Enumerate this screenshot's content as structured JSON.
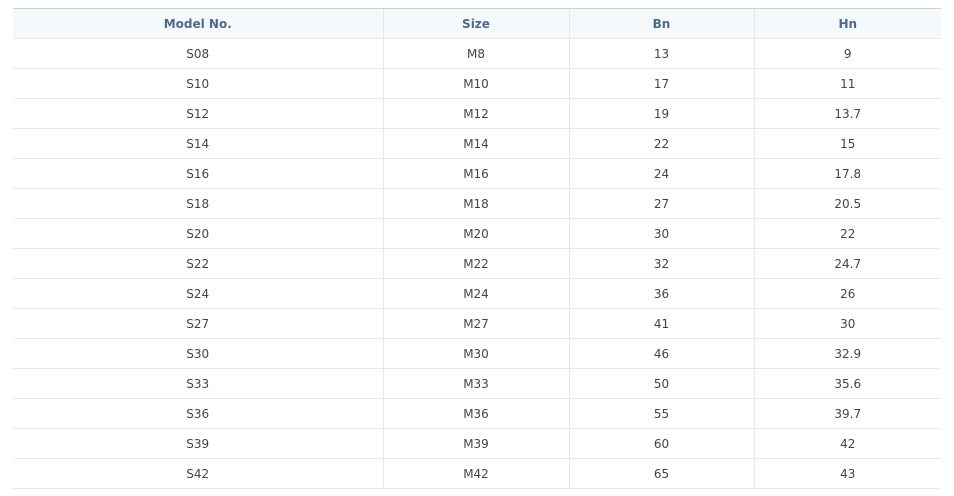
{
  "table": {
    "headers": [
      "Model No.",
      "Size",
      "Bn",
      "Hn"
    ],
    "rows": [
      [
        "S08",
        "M8",
        "13",
        "9"
      ],
      [
        "S10",
        "M10",
        "17",
        "11"
      ],
      [
        "S12",
        "M12",
        "19",
        "13.7"
      ],
      [
        "S14",
        "M14",
        "22",
        "15"
      ],
      [
        "S16",
        "M16",
        "24",
        "17.8"
      ],
      [
        "S18",
        "M18",
        "27",
        "20.5"
      ],
      [
        "S20",
        "M20",
        "30",
        "22"
      ],
      [
        "S22",
        "M22",
        "32",
        "24.7"
      ],
      [
        "S24",
        "M24",
        "36",
        "26"
      ],
      [
        "S27",
        "M27",
        "41",
        "30"
      ],
      [
        "S30",
        "M30",
        "46",
        "32.9"
      ],
      [
        "S33",
        "M33",
        "50",
        "35.6"
      ],
      [
        "S36",
        "M36",
        "55",
        "39.7"
      ],
      [
        "S39",
        "M39",
        "60",
        "42"
      ],
      [
        "S42",
        "M42",
        "65",
        "43"
      ]
    ]
  },
  "colors": {
    "header_text": "#4a6a92",
    "header_bg": "#f5f9fc",
    "cell_text": "#444444",
    "border": "#e4e9ee"
  }
}
